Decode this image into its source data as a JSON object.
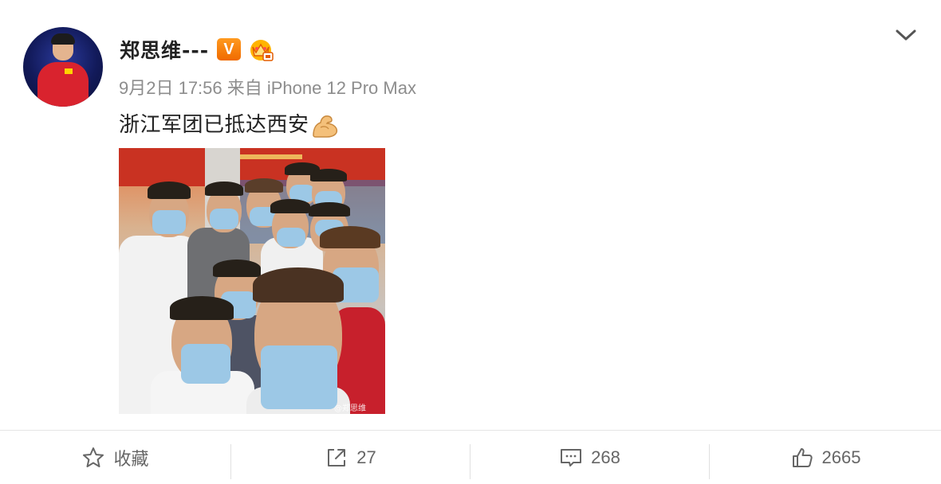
{
  "post": {
    "username": "郑思维---",
    "vip_badge": "V",
    "meta": "9月2日 17:56 来自 iPhone 12 Pro Max",
    "text": "浙江军团已抵达西安",
    "image_watermark": "@郑思维"
  },
  "actions": {
    "favorite_label": "收藏",
    "repost_count": "27",
    "comment_count": "268",
    "like_count": "2665"
  },
  "icons": {
    "menu": "chevron-down-icon",
    "verified": "vip-badge-icon",
    "member": "crown-icon",
    "emoji": "flexed-biceps-icon",
    "favorite": "star-icon",
    "repost": "share-icon",
    "comment": "comment-icon",
    "like": "thumbs-up-icon"
  },
  "colors": {
    "vip": "#f06a00",
    "text_muted": "#8d8d8d"
  }
}
